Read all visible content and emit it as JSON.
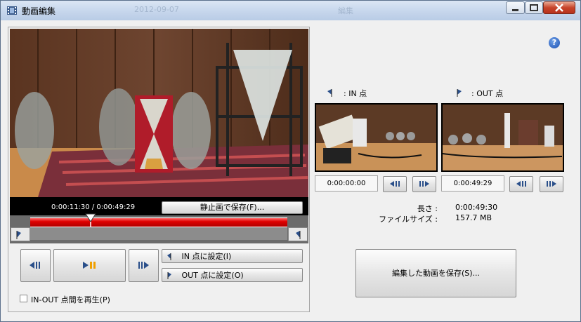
{
  "window": {
    "title": "動画編集",
    "ghost_date": "2012-09-07",
    "ghost_title": "編集"
  },
  "player": {
    "time_current": "0:00:11:30",
    "time_separator": "/",
    "time_total": "0:00:49:29",
    "playhead_fraction": 0.234,
    "save_still_label": "静止画で保存(F)..."
  },
  "controls": {
    "set_in_label": "IN 点に設定(I)",
    "set_out_label": "OUT 点に設定(O)",
    "play_inout_label": "IN-OUT 点間を再生(P)",
    "play_inout_checked": false
  },
  "in_point": {
    "label": ": IN 点",
    "time": "0:00:00:00"
  },
  "out_point": {
    "label": ": OUT 点",
    "time": "0:00:49:29"
  },
  "info": {
    "length_label": "長さ :",
    "length_value": "0:00:49:30",
    "size_label": "ファイルサイズ :",
    "size_value": "157.7 MB"
  },
  "save_video_label": "編集した動画を保存(S)...",
  "colors": {
    "range_red": "#e00000",
    "play_orange": "#f0a000",
    "icon_blue": "#2a4f8a"
  }
}
